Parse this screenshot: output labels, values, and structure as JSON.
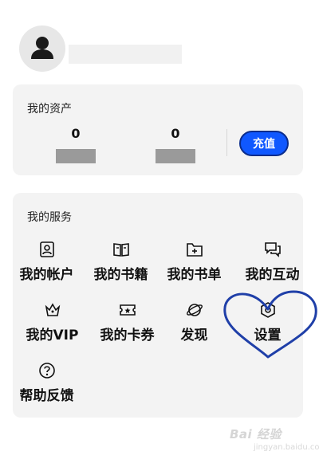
{
  "profile": {
    "avatar": "person-silhouette"
  },
  "assets": {
    "title": "我的资产",
    "items": [
      {
        "value": "0"
      },
      {
        "value": "0"
      }
    ],
    "recharge_label": "充值",
    "recharge_color": "#1058ff"
  },
  "services": {
    "title": "我的服务",
    "items": [
      {
        "label": "我的帐户",
        "icon": "account-icon"
      },
      {
        "label": "我的书籍",
        "icon": "book-icon"
      },
      {
        "label": "我的书单",
        "icon": "folder-add-icon"
      },
      {
        "label": "我的互动",
        "icon": "chat-icon"
      },
      {
        "label": "我的VIP",
        "icon": "crown-icon"
      },
      {
        "label": "我的卡券",
        "icon": "ticket-icon"
      },
      {
        "label": "发现",
        "icon": "planet-icon"
      },
      {
        "label": "设置",
        "icon": "settings-icon"
      },
      {
        "label": "帮助反馈",
        "icon": "help-icon"
      }
    ]
  },
  "annotation": {
    "shape": "heart",
    "color": "#1f3fa8"
  },
  "watermark": {
    "text": "Bai 经验",
    "sub": "jingyan.baidu.com"
  }
}
